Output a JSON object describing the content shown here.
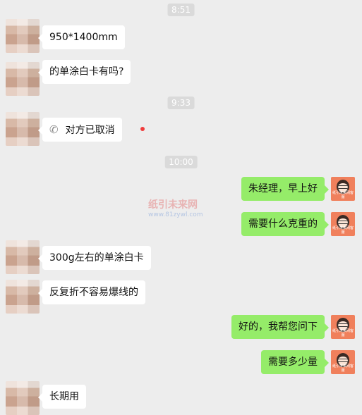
{
  "timestamps": [
    "8:51",
    "9:33",
    "10:00"
  ],
  "messages": [
    {
      "side": "left",
      "text": "950*1400mm"
    },
    {
      "side": "left",
      "text": "的单涂白卡有吗?"
    },
    {
      "side": "left",
      "type": "call",
      "text": "对方已取消"
    },
    {
      "side": "right",
      "text": "朱经理，早上好"
    },
    {
      "side": "right",
      "text": "需要什么克重的"
    },
    {
      "side": "left",
      "text": "300g左右的单涂白卡"
    },
    {
      "side": "left",
      "text": "反复折不容易爆线的"
    },
    {
      "side": "right",
      "text": "好的，我帮您问下"
    },
    {
      "side": "right",
      "text": "需要多少量"
    },
    {
      "side": "left",
      "text": "长期用"
    }
  ],
  "watermark": {
    "title": "纸引未来网",
    "url": "www.81zywl.com"
  },
  "avatar_caption": "纸引未来网客服",
  "colors": {
    "background": "#ededed",
    "incoming": "#ffffff",
    "outgoing": "#95ec69",
    "unread_dot": "#f03c3c"
  },
  "icons": {
    "call": "phone-icon"
  }
}
